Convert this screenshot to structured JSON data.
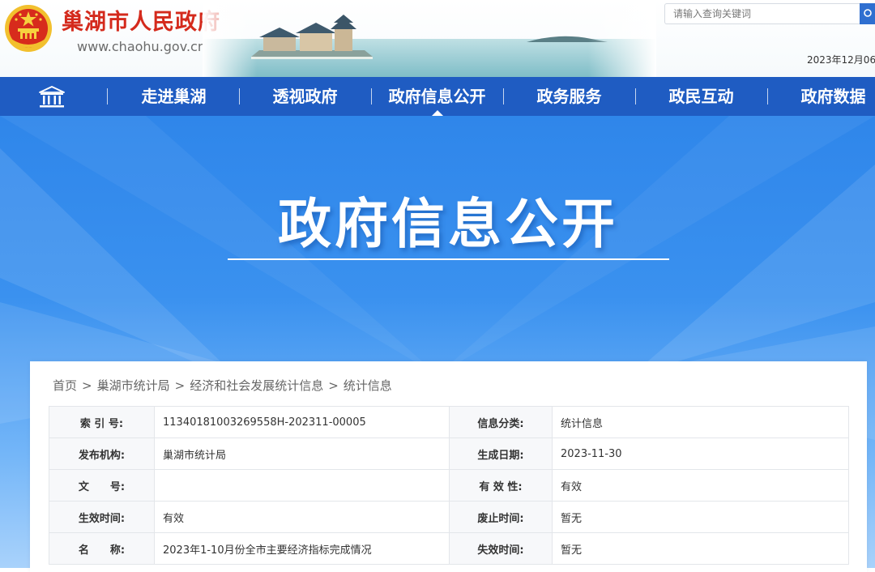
{
  "header": {
    "site_title": "巢湖市人民政府",
    "site_url": "www.chaohu.gov.cn",
    "search_placeholder": "请输入查询关键词",
    "date": "2023年12月06"
  },
  "nav": {
    "items": [
      {
        "label": "走进巢湖"
      },
      {
        "label": "透视政府"
      },
      {
        "label": "政府信息公开"
      },
      {
        "label": "政务服务"
      },
      {
        "label": "政民互动"
      },
      {
        "label": "政府数据"
      }
    ],
    "active_index": 2
  },
  "banner": {
    "title": "政府信息公开"
  },
  "breadcrumb": [
    "首页",
    "巢湖市统计局",
    "经济和社会发展统计信息",
    "统计信息"
  ],
  "info_table": {
    "rows": [
      {
        "l1": "索 引 号:",
        "v1": "11340181003269558H-202311-00005",
        "l2": "信息分类:",
        "v2": "统计信息"
      },
      {
        "l1": "发布机构:",
        "v1": "巢湖市统计局",
        "l2": "生成日期:",
        "v2": "2023-11-30"
      },
      {
        "l1": "文　　号:",
        "v1": "",
        "l2": "有 效 性:",
        "v2": "有效"
      },
      {
        "l1": "生效时间:",
        "v1": "有效",
        "l2": "废止时间:",
        "v2": "暂无"
      },
      {
        "l1": "名　　称:",
        "v1": "2023年1-10月份全市主要经济指标完成情况",
        "l2": "失效时间:",
        "v2": "暂无"
      }
    ]
  },
  "colors": {
    "brand_red": "#d42a1c",
    "nav_blue": "#1f5cc2",
    "banner_blue": "#2f86ea"
  }
}
